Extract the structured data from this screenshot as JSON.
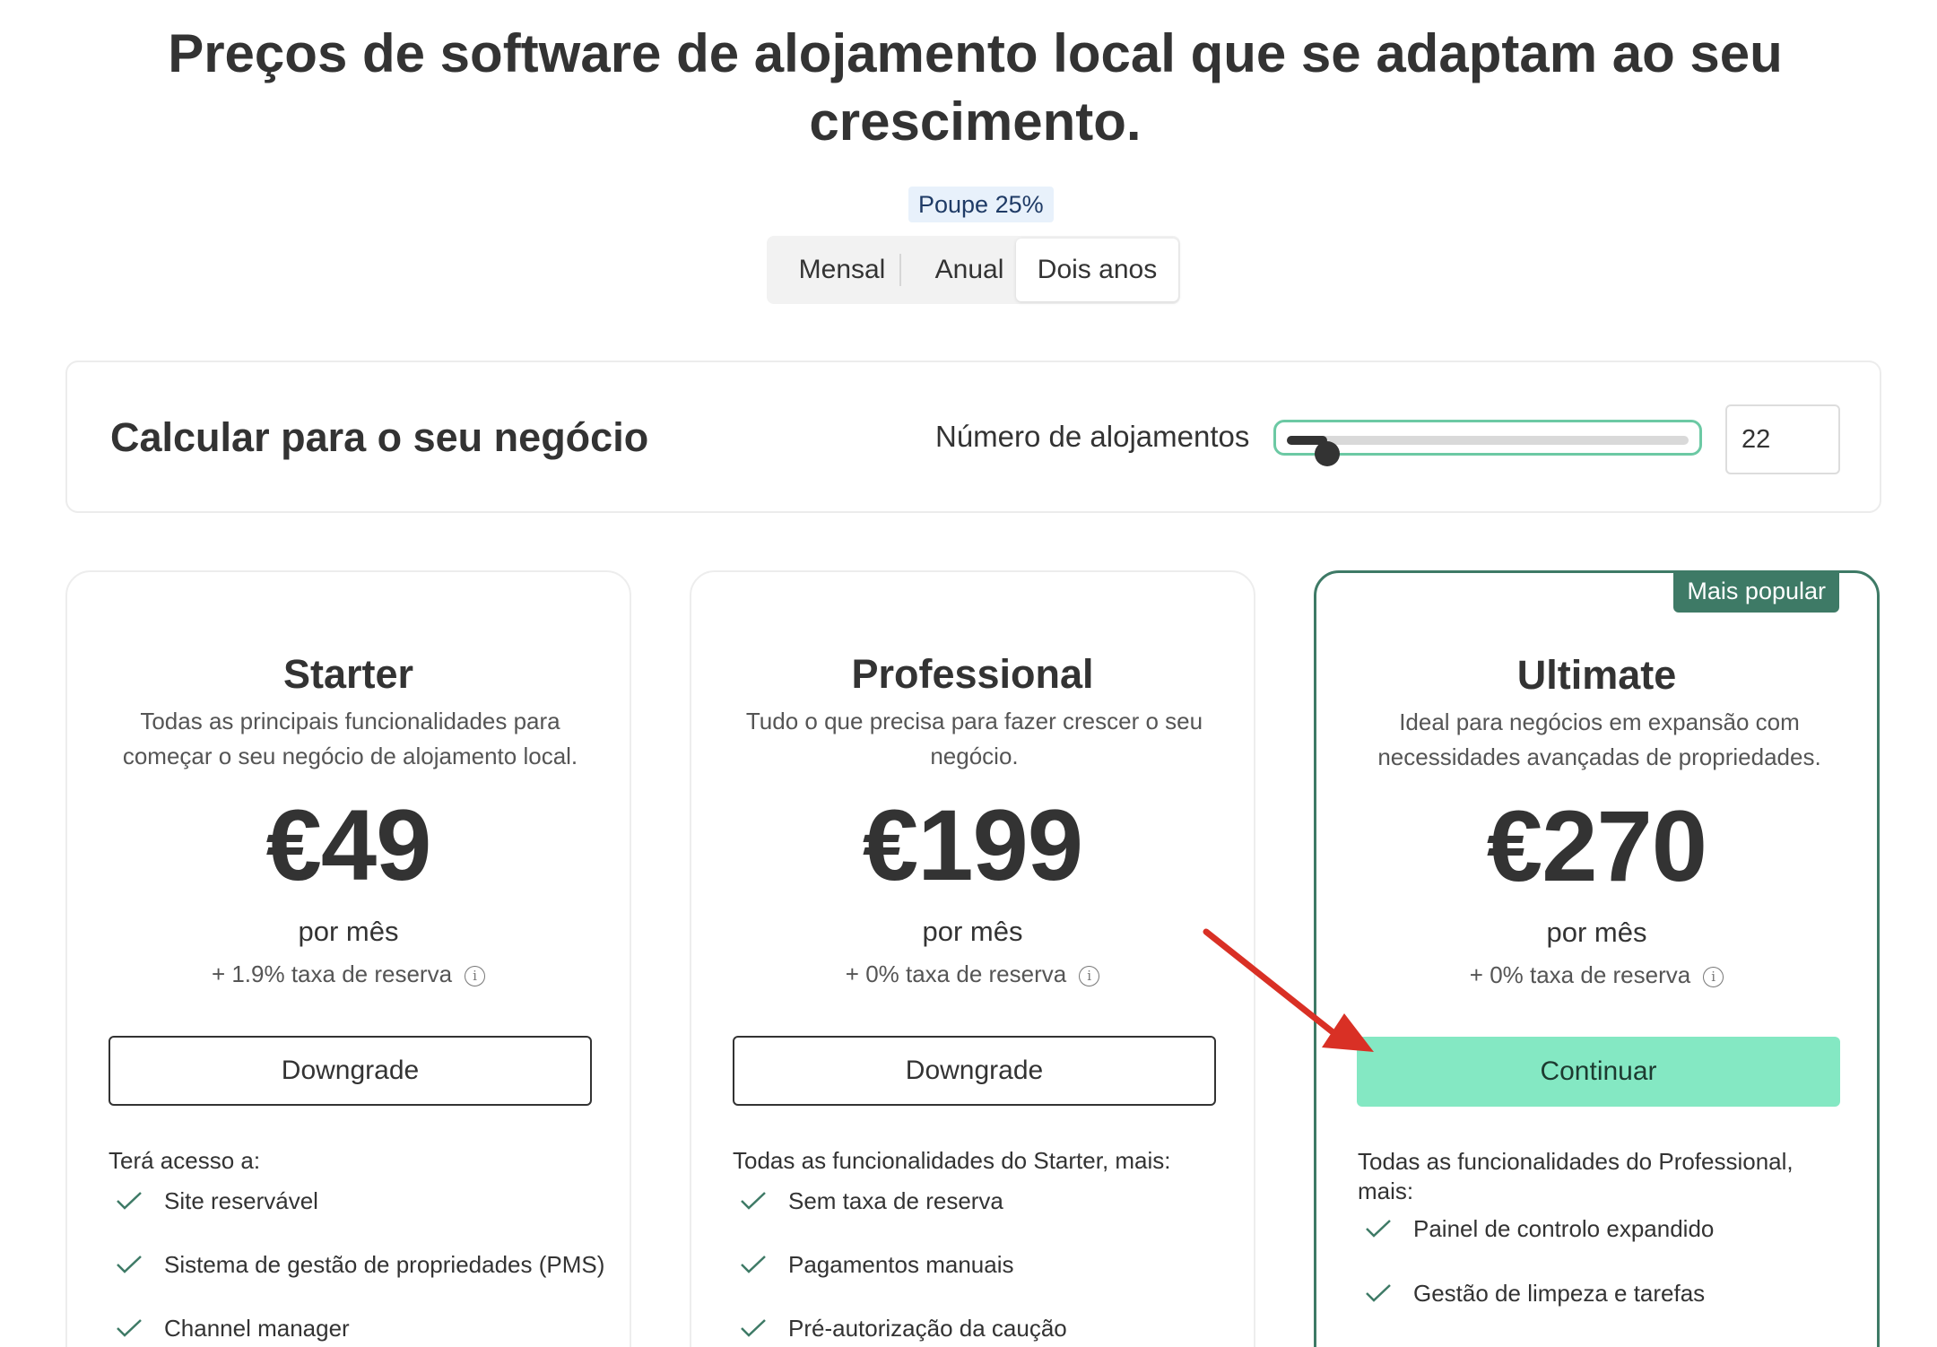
{
  "header": {
    "title": "Preços de software de alojamento local que se adaptam ao seu crescimento.",
    "save_badge": "Poupe 25%"
  },
  "billing": {
    "options": [
      "Mensal",
      "Anual",
      "Dois anos"
    ],
    "selected": "Dois anos"
  },
  "calculator": {
    "title": "Calcular para o seu negócio",
    "units_label": "Número de alojamentos",
    "units_value": "22",
    "slider_level": 0.1
  },
  "plans": [
    {
      "name": "Starter",
      "description": "Todas as principais funcionalidades para começar o seu negócio de alojamento local.",
      "price": "€49",
      "period": "por mês",
      "fee": "+ 1.9% taxa de reserva",
      "button": "Downgrade",
      "features_intro": "Terá acesso a:",
      "features": [
        "Site reservável",
        "Sistema de gestão de propriedades (PMS)",
        "Channel manager"
      ]
    },
    {
      "name": "Professional",
      "description": "Tudo o que precisa para fazer crescer o seu negócio.",
      "price": "€199",
      "period": "por mês",
      "fee": "+ 0% taxa de reserva",
      "button": "Downgrade",
      "features_intro": "Todas as funcionalidades do Starter, mais:",
      "features": [
        "Sem taxa de reserva",
        "Pagamentos manuais",
        "Pré-autorização da caução"
      ]
    },
    {
      "name": "Ultimate",
      "badge": "Mais popular",
      "description": "Ideal para negócios em expansão com necessidades avançadas de propriedades.",
      "price": "€270",
      "period": "por mês",
      "fee": "+ 0% taxa de reserva",
      "button": "Continuar",
      "features_intro": "Todas as funcionalidades do Professional, mais:",
      "features": [
        "Painel de controlo expandido",
        "Gestão de limpeza e tarefas"
      ]
    }
  ],
  "colors": {
    "accent_green": "#3e7a66",
    "continue_button": "#84e8c3",
    "annotation_arrow": "#d93025"
  }
}
